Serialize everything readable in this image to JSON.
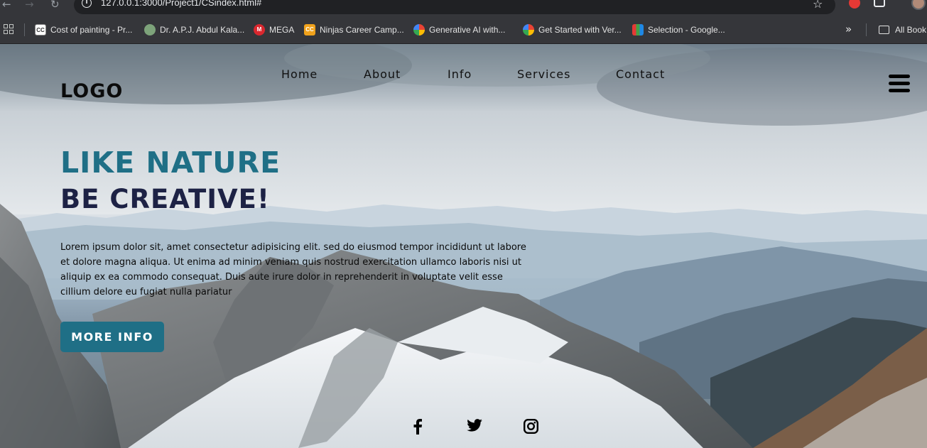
{
  "browser": {
    "url": "127.0.0.1:3000/Project1/CSindex.html#",
    "bookmarks": [
      {
        "label": "Cost of painting - Pr...",
        "icon": "cc-favicon"
      },
      {
        "label": "Dr. A.P.J. Abdul Kala...",
        "icon": "apj-favicon"
      },
      {
        "label": "MEGA",
        "icon": "mega-favicon"
      },
      {
        "label": "Ninjas Career Camp...",
        "icon": "ninjas-favicon"
      },
      {
        "label": "Generative AI with...",
        "icon": "google-cloud-favicon"
      },
      {
        "label": "Get Started with Ver...",
        "icon": "google-cloud-favicon"
      },
      {
        "label": "Selection - Google...",
        "icon": "zoho-favicon"
      }
    ],
    "all_bookmarks_label": "All Book"
  },
  "page": {
    "logo": "LOGO",
    "nav": [
      "Home",
      "About",
      "Info",
      "Services",
      "Contact"
    ],
    "headline_1": "LIKE NATURE",
    "headline_2": "BE CREATIVE!",
    "paragraph": "Lorem ipsum dolor sit, amet consectetur adipisicing elit. sed do eiusmod tempor incididunt ut labore et dolore magna aliqua. Ut enima ad minim veniam quis nostrud exercitation ullamco laboris nisi ut aliquip ex ea commodo consequat. Duis aute irure dolor in reprehenderit in voluptate velit esse cillium delore eu fugiat nulla pariatur",
    "cta_label": "MORE INFO",
    "social": [
      "facebook-icon",
      "twitter-icon",
      "instagram-icon"
    ],
    "colors": {
      "accent": "#1f6f86",
      "headline_dark": "#1d2245"
    }
  }
}
